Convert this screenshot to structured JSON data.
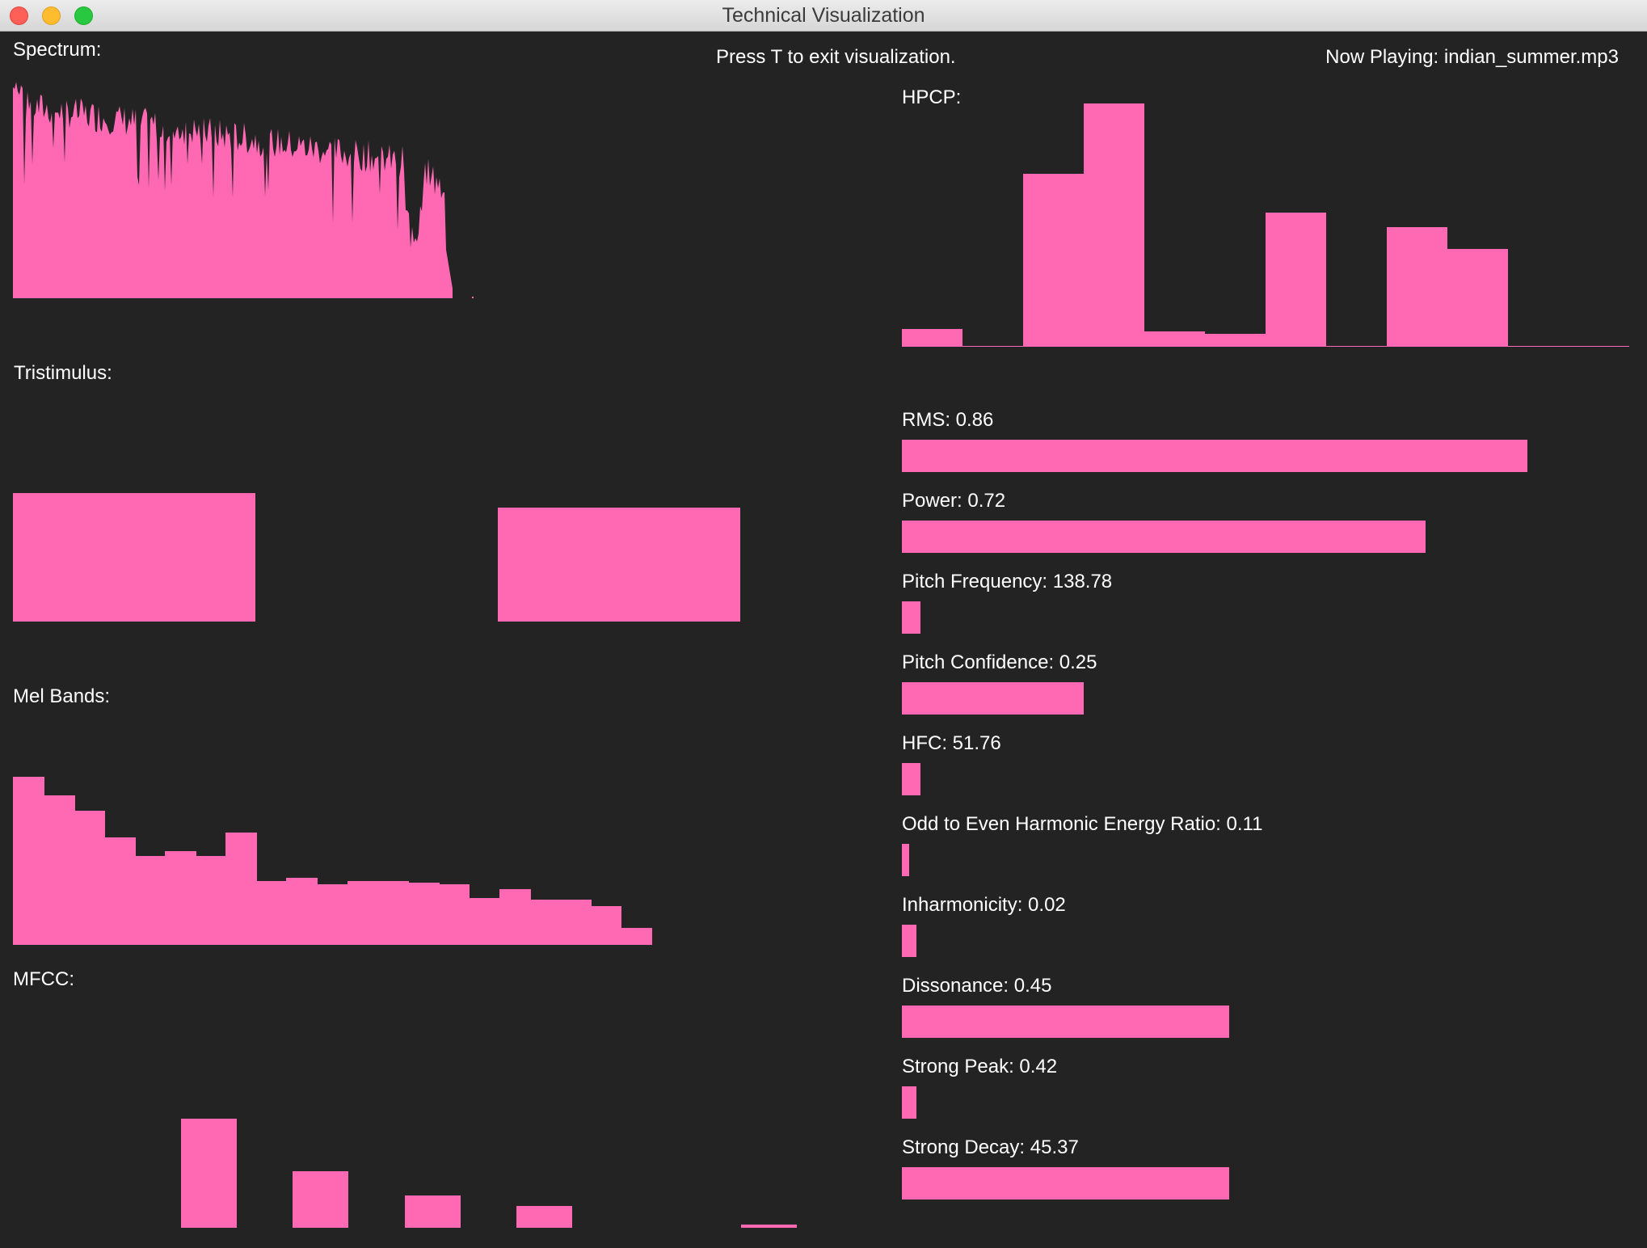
{
  "window": {
    "title": "Technical Visualization"
  },
  "header": {
    "exit_hint": "Press T to exit visualization.",
    "now_playing": "Now Playing: indian_summer.mp3"
  },
  "colors": {
    "background": "#232323",
    "bar": "#ff69b4",
    "text": "#ffffff"
  },
  "panels": {
    "spectrum": {
      "label": "Spectrum:"
    },
    "tristimulus": {
      "label": "Tristimulus:",
      "values": [
        0.53,
        0.0,
        0.47
      ]
    },
    "mel_bands": {
      "label": "Mel Bands:",
      "values": [
        1.0,
        0.89,
        0.8,
        0.64,
        0.53,
        0.56,
        0.53,
        0.67,
        0.38,
        0.4,
        0.36,
        0.38,
        0.38,
        0.37,
        0.36,
        0.28,
        0.33,
        0.27,
        0.27,
        0.23,
        0.1
      ]
    },
    "mfcc": {
      "label": "MFCC:",
      "values": [
        0.0,
        0.71,
        0.37,
        0.21,
        0.14,
        0.0,
        0.02
      ]
    },
    "hpcp": {
      "label": "HPCP:",
      "values": [
        0.07,
        0.0,
        0.71,
        1.0,
        0.06,
        0.05,
        0.55,
        0.0,
        0.49,
        0.4,
        0.0,
        0.0
      ]
    }
  },
  "metrics": [
    {
      "label": "RMS: 0.86",
      "level": 0.86
    },
    {
      "label": "Power: 0.72",
      "level": 0.72
    },
    {
      "label": "Pitch Frequency: 138.78",
      "level": 0.025
    },
    {
      "label": "Pitch Confidence: 0.25",
      "level": 0.25
    },
    {
      "label": "HFC: 51.76",
      "level": 0.025
    },
    {
      "label": "Odd to Even Harmonic Energy Ratio: 0.11",
      "level": 0.01
    },
    {
      "label": "Inharmonicity: 0.02",
      "level": 0.02
    },
    {
      "label": "Dissonance: 0.45",
      "level": 0.45
    },
    {
      "label": "Strong Peak: 0.42",
      "level": 0.02
    },
    {
      "label": "Strong Decay: 45.37",
      "level": 0.45
    }
  ]
}
